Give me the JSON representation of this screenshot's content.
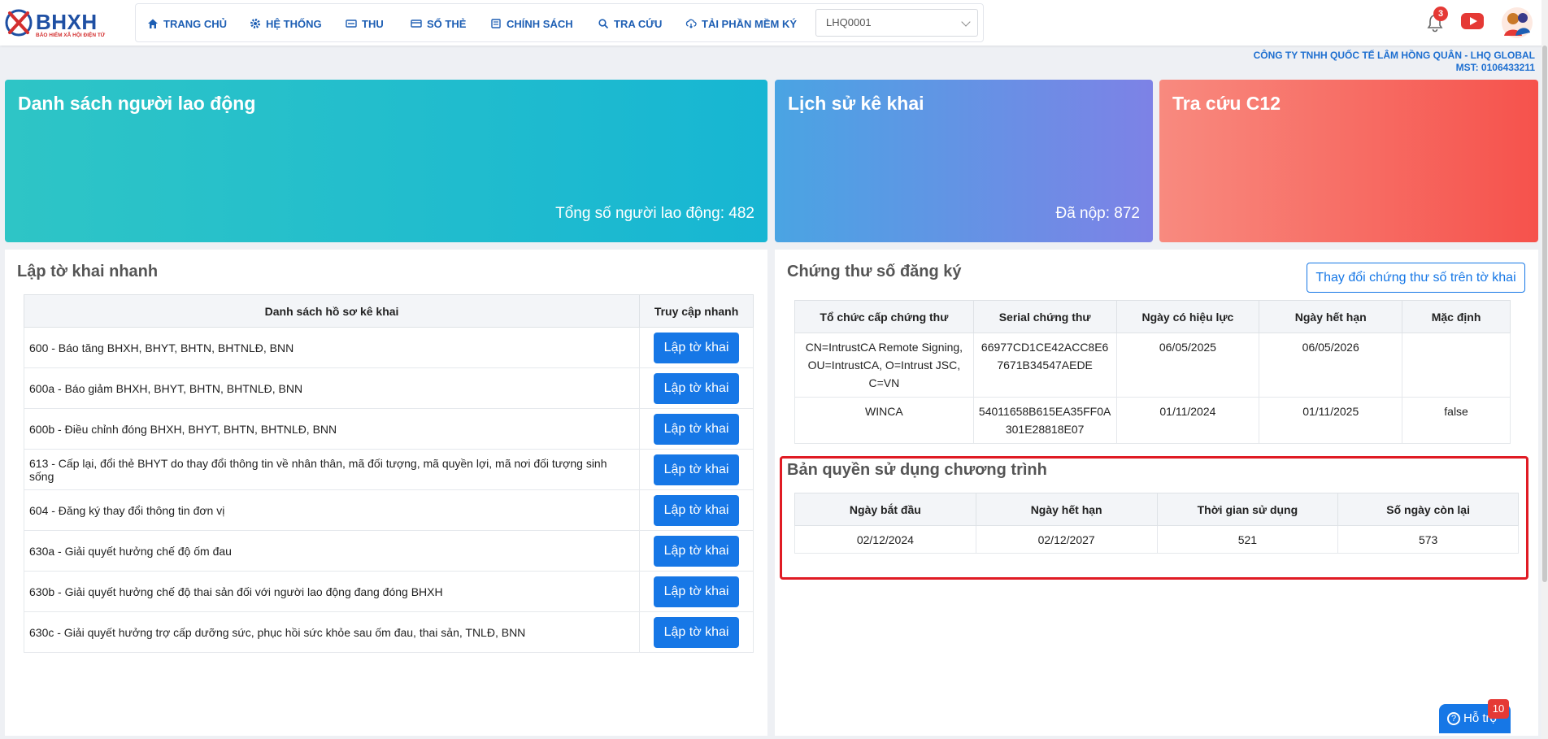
{
  "brand": {
    "name": "BHXH",
    "tagline": "BẢO HIỂM XÃ HỘI ĐIỆN TỬ"
  },
  "nav": [
    {
      "label": "TRANG CHỦ",
      "icon": "home-icon"
    },
    {
      "label": "HỆ THỐNG",
      "icon": "gear-icon"
    },
    {
      "label": "THU",
      "icon": "money-icon"
    },
    {
      "label": "SỔ THẺ",
      "icon": "card-icon"
    },
    {
      "label": "CHÍNH SÁCH",
      "icon": "policy-icon"
    },
    {
      "label": "TRA CỨU",
      "icon": "search-icon"
    },
    {
      "label": "TẢI PHẦN MỀM KÝ",
      "icon": "cloud-download-icon"
    }
  ],
  "unit_select": {
    "value": "LHQ0001"
  },
  "notifications": {
    "count": "3"
  },
  "company": {
    "name": "CÔNG TY TNHH QUỐC TẾ LÂM HỒNG QUÂN - LHQ GLOBAL",
    "tax_code": "MST: 0106433211"
  },
  "cards": {
    "workers": {
      "title": "Danh sách người lao động",
      "stat": "Tổng số người lao động: 482"
    },
    "history": {
      "title": "Lịch sử kê khai",
      "stat": "Đã nộp: 872"
    },
    "lookup": {
      "title": "Tra cứu C12"
    }
  },
  "quick_forms": {
    "title": "Lập tờ khai nhanh",
    "headers": [
      "Danh sách hồ sơ kê khai",
      "Truy cập nhanh"
    ],
    "action_label": "Lập tờ khai",
    "rows": [
      "600 - Báo tăng BHXH, BHYT, BHTN, BHTNLĐ, BNN",
      "600a - Báo giảm BHXH, BHYT, BHTN, BHTNLĐ, BNN",
      "600b - Điều chỉnh đóng BHXH, BHYT, BHTN, BHTNLĐ, BNN",
      "613 - Cấp lại, đổi thẻ BHYT do thay đổi thông tin về nhân thân, mã đối tượng, mã quyền lợi, mã nơi đối tượng sinh sống",
      "604 - Đăng ký thay đổi thông tin đơn vị",
      "630a - Giải quyết hưởng chế độ ốm đau",
      "630b - Giải quyết hưởng chế độ thai sản đối với người lao động đang đóng BHXH",
      "630c - Giải quyết hưởng trợ cấp dưỡng sức, phục hồi sức khỏe sau ốm đau, thai sản, TNLĐ, BNN"
    ]
  },
  "certificates": {
    "title": "Chứng thư số đăng ký",
    "change_button": "Thay đổi chứng thư số trên tờ khai",
    "headers": [
      "Tổ chức cấp chứng thư",
      "Serial chứng thư",
      "Ngày có hiệu lực",
      "Ngày hết hạn",
      "Mặc định"
    ],
    "rows": [
      [
        "CN=IntrustCA Remote Signing, OU=IntrustCA, O=Intrust JSC, C=VN",
        "66977CD1CE42ACC8E67671B34547AEDE",
        "06/05/2025",
        "06/05/2026",
        ""
      ],
      [
        "WINCA",
        "54011658B615EA35FF0A301E28818E07",
        "01/11/2024",
        "01/11/2025",
        "false"
      ]
    ]
  },
  "license": {
    "title": "Bản quyền sử dụng chương trình",
    "headers": [
      "Ngày bắt đầu",
      "Ngày hết hạn",
      "Thời gian sử dụng",
      "Số ngày còn lại"
    ],
    "row": [
      "02/12/2024",
      "02/12/2027",
      "521",
      "573"
    ]
  },
  "support": {
    "label": "Hỗ trợ",
    "badge": "10"
  }
}
